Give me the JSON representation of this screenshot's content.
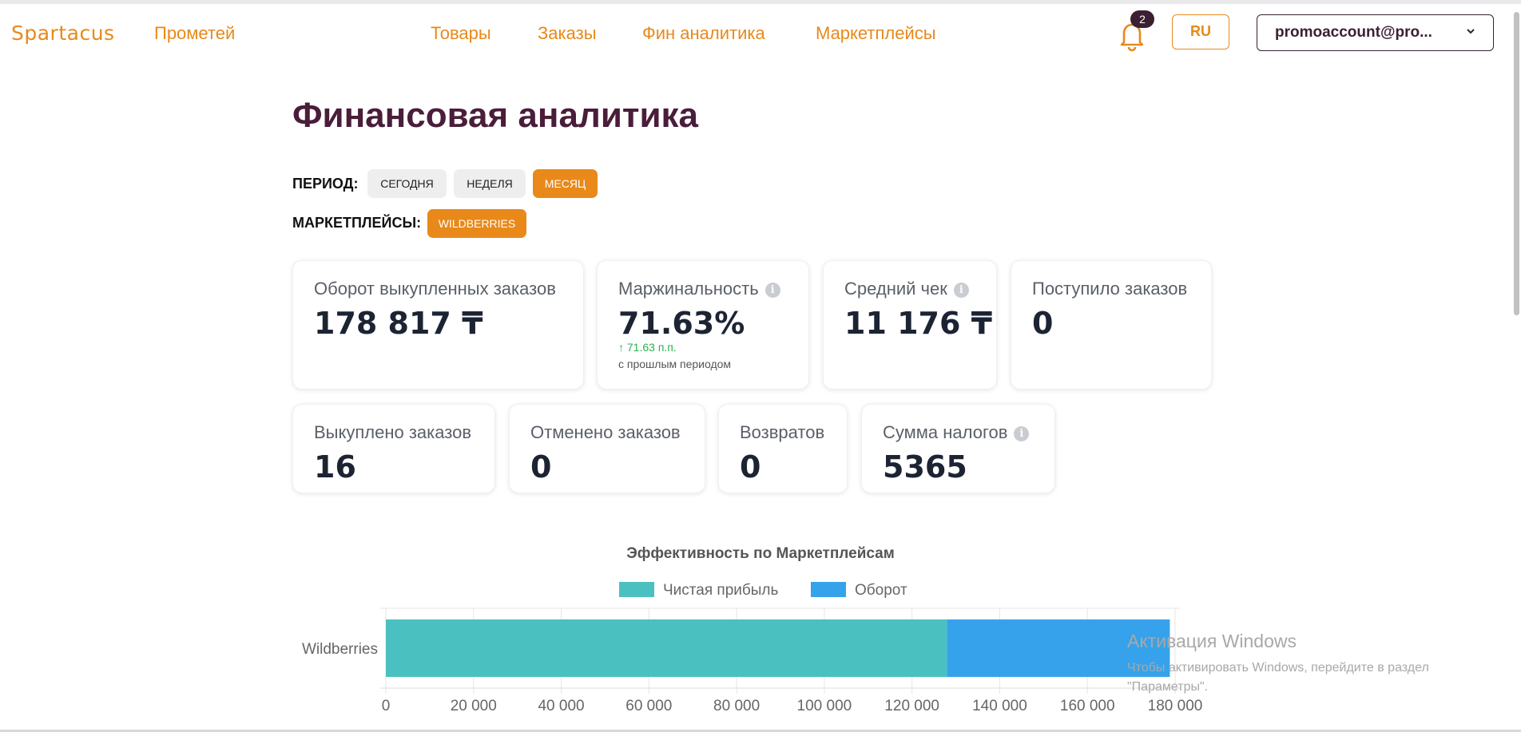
{
  "header": {
    "logo": "Spartacus",
    "brand_link": "Прометей",
    "nav": [
      {
        "label": "Товары"
      },
      {
        "label": "Заказы"
      },
      {
        "label": "Фин аналитика"
      },
      {
        "label": "Маркетплейсы"
      }
    ],
    "notification_count": "2",
    "language": "RU",
    "account": "promoaccount@pro...",
    "icons": {
      "notifications": "bell-icon",
      "account_menu": "chevron-down-icon"
    }
  },
  "page": {
    "title": "Финансовая аналитика",
    "period_label": "ПЕРИОД:",
    "period_options": [
      {
        "label": "Сегодня",
        "selected": false
      },
      {
        "label": "Неделя",
        "selected": false
      },
      {
        "label": "Месяц",
        "selected": true
      }
    ],
    "marketplaces_label": "МАРКЕТПЛЕЙСЫ:",
    "marketplace_options": [
      {
        "label": "Wildberries",
        "selected": true
      }
    ]
  },
  "metrics_row1": [
    {
      "label": "Оборот выкупленных заказов",
      "value": "178 817 ₸",
      "info": false
    },
    {
      "label": "Маржинальность",
      "value": "71.63%",
      "info": true,
      "delta": "↑ 71.63 п.п.",
      "delta_note": "с прошлым периодом"
    },
    {
      "label": "Средний чек",
      "value": "11 176 ₸",
      "info": true
    },
    {
      "label": "Поступило заказов",
      "value": "0",
      "info": false
    }
  ],
  "metrics_row2": [
    {
      "label": "Выкуплено заказов",
      "value": "16",
      "info": false
    },
    {
      "label": "Отменено заказов",
      "value": "0",
      "info": false
    },
    {
      "label": "Возвратов",
      "value": "0",
      "info": false
    },
    {
      "label": "Сумма налогов",
      "value": "5365",
      "info": true
    }
  ],
  "chart_data": {
    "type": "bar",
    "orientation": "horizontal",
    "stacked": true,
    "title": "Эффективность по Маркетплейсам",
    "categories": [
      "Wildberries"
    ],
    "series": [
      {
        "name": "Чистая прибыль",
        "values": [
          128000
        ],
        "color": "#4bc0c0"
      },
      {
        "name": "Оборот",
        "values": [
          50800
        ],
        "color": "#36a2eb"
      }
    ],
    "xlim": [
      0,
      180000
    ],
    "xticks": [
      "0",
      "20 000",
      "40 000",
      "60 000",
      "80 000",
      "100 000",
      "120 000",
      "140 000",
      "160 000",
      "180 000"
    ],
    "legend_position": "top",
    "grid": true
  },
  "watermark": {
    "title": "Активация Windows",
    "line1": "Чтобы активировать Windows, перейдите в раздел",
    "line2": "\"Параметры\"."
  }
}
